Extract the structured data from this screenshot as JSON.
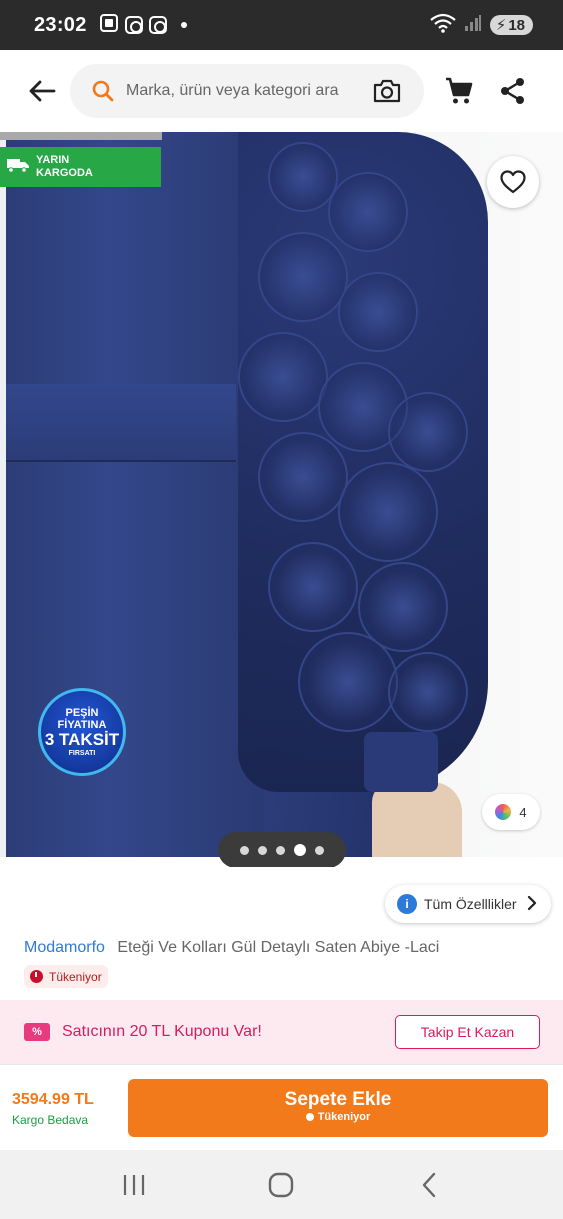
{
  "status_bar": {
    "time": "23:02",
    "battery": "18"
  },
  "header": {
    "search_placeholder": "Marka, ürün veya kategori ara"
  },
  "gallery": {
    "cargo_badge_line1": "YARIN",
    "cargo_badge_line2": "KARGODA",
    "taksit_line1": "PEŞİN FİYATINA",
    "taksit_line2": "3 TAKSİT",
    "taksit_line3": "FIRSATI",
    "variant_count": "4",
    "pager_dots": 5,
    "active_dot": 4
  },
  "details": {
    "specs_label": "Tüm Özelllikler",
    "brand": "Modamorfo",
    "title": "Eteği Ve Kolları Gül Detaylı Saten Abiye -Laci",
    "stock_badge": "Tükeniyor"
  },
  "coupon": {
    "icon_text": "%",
    "text": "Satıcının 20 TL Kuponu Var!",
    "follow_label": "Takip Et Kazan"
  },
  "buy_bar": {
    "price": "3594.99 TL",
    "shipping": "Kargo Bedava",
    "cart_label": "Sepete Ekle",
    "cart_sub": "Tükeniyor"
  },
  "colors": {
    "brand_orange": "#f27a1a",
    "green_badge": "#27a745",
    "coupon_pink": "#d81b60",
    "link_blue": "#2e7ad8"
  }
}
